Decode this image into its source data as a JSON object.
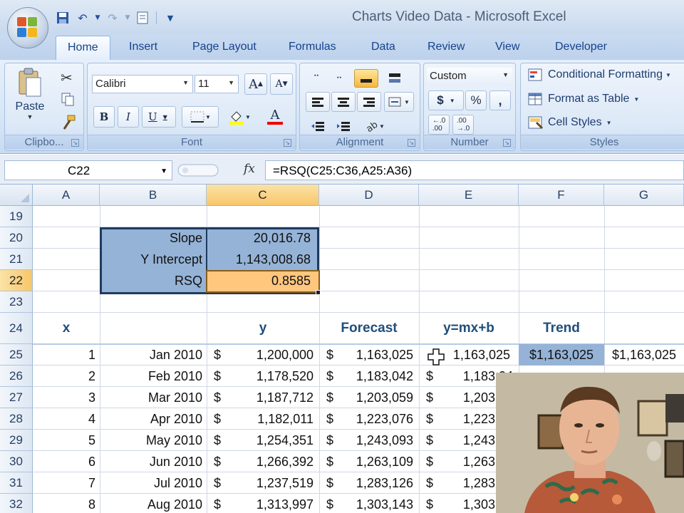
{
  "window": {
    "title": "Charts Video Data - Microsoft Excel"
  },
  "ribbon": {
    "tabs": [
      "Home",
      "Insert",
      "Page Layout",
      "Formulas",
      "Data",
      "Review",
      "View",
      "Developer"
    ],
    "active_tab": "Home",
    "clipboard": {
      "paste_label": "Paste",
      "group_label": "Clipbo..."
    },
    "font": {
      "name": "Calibri",
      "size": "11",
      "group_label": "Font",
      "bold": "B",
      "italic": "I",
      "underline": "U",
      "grow": "A",
      "shrink": "A"
    },
    "alignment": {
      "group_label": "Alignment"
    },
    "number": {
      "format": "Custom",
      "currency": "$",
      "percent": "%",
      "comma": ",",
      "group_label": "Number"
    },
    "styles": {
      "conditional_formatting": "Conditional Formatting",
      "format_as_table": "Format as Table",
      "cell_styles": "Cell Styles",
      "group_label": "Styles"
    }
  },
  "formula_bar": {
    "name_box": "C22",
    "fx": "fx",
    "formula": "=RSQ(C25:C36,A25:A36)"
  },
  "grid": {
    "columns": [
      "A",
      "B",
      "C",
      "D",
      "E",
      "F",
      "G"
    ],
    "selected_column": "C",
    "rows": [
      "19",
      "20",
      "21",
      "22",
      "23",
      "24",
      "25",
      "26",
      "27",
      "28",
      "29",
      "30",
      "31",
      "32"
    ],
    "selected_row": "22",
    "stats": [
      {
        "label": "Slope",
        "value": "20,016.78"
      },
      {
        "label": "Y Intercept",
        "value": "1,143,008.68"
      },
      {
        "label": "RSQ",
        "value": "0.8585"
      }
    ],
    "headers": {
      "x": "x",
      "y": "y",
      "forecast": "Forecast",
      "ymxb": "y=mx+b",
      "trend": "Trend"
    },
    "currency": "$",
    "data_rows": [
      {
        "x": "1",
        "date": "Jan 2010",
        "y": "1,200,000",
        "forecast": "1,163,025",
        "ymxb": "1,163,025",
        "trend": "$1,163,025",
        "g": "$1,163,025"
      },
      {
        "x": "2",
        "date": "Feb 2010",
        "y": "1,178,520",
        "forecast": "1,183,042",
        "ymxb": "1,183,04"
      },
      {
        "x": "3",
        "date": "Mar 2010",
        "y": "1,187,712",
        "forecast": "1,203,059",
        "ymxb": "1,203,05"
      },
      {
        "x": "4",
        "date": "Apr 2010",
        "y": "1,182,011",
        "forecast": "1,223,076",
        "ymxb": "1,223,07"
      },
      {
        "x": "5",
        "date": "May 2010",
        "y": "1,254,351",
        "forecast": "1,243,093",
        "ymxb": "1,243,09"
      },
      {
        "x": "6",
        "date": "Jun 2010",
        "y": "1,266,392",
        "forecast": "1,263,109",
        "ymxb": "1,263,10"
      },
      {
        "x": "7",
        "date": "Jul 2010",
        "y": "1,237,519",
        "forecast": "1,283,126",
        "ymxb": "1,283,12"
      },
      {
        "x": "8",
        "date": "Aug 2010",
        "y": "1,313,997",
        "forecast": "1,303,143",
        "ymxb": "1,303,14"
      }
    ]
  }
}
